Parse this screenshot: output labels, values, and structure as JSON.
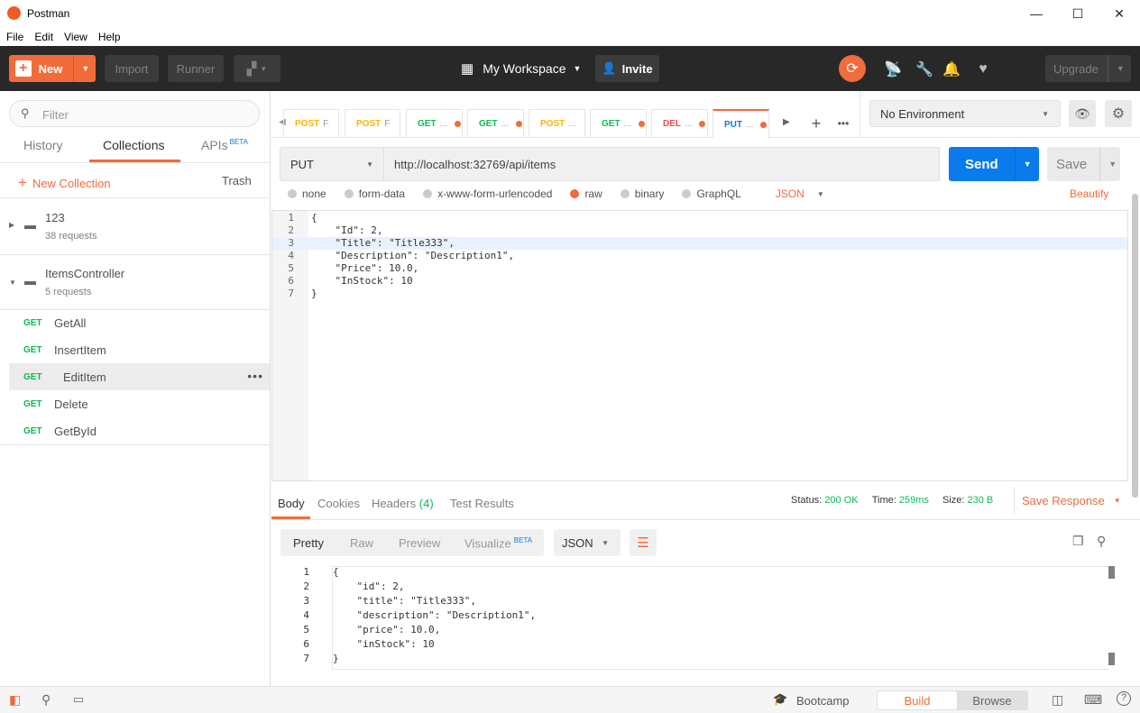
{
  "window": {
    "title": "Postman",
    "minimize": "—",
    "maximize": "☐",
    "close": "✕"
  },
  "menu": [
    "File",
    "Edit",
    "View",
    "Help"
  ],
  "header": {
    "new_label": "New",
    "import_label": "Import",
    "runner_label": "Runner",
    "workspace_label": "My Workspace",
    "invite_label": "Invite",
    "upgrade_label": "Upgrade"
  },
  "sidebar": {
    "filter_placeholder": "Filter",
    "tabs": [
      "History",
      "Collections",
      "APIs"
    ],
    "apis_badge": "BETA",
    "new_collection": "New Collection",
    "trash": "Trash",
    "collections": [
      {
        "name": "123",
        "count": "38 requests"
      },
      {
        "name": "ItemsController",
        "count": "5 requests"
      }
    ],
    "requests": [
      {
        "method": "GET",
        "name": "GetAll"
      },
      {
        "method": "GET",
        "name": "InsertItem"
      },
      {
        "method": "GET",
        "name": "EditItem"
      },
      {
        "method": "GET",
        "name": "Delete"
      },
      {
        "method": "GET",
        "name": "GetById"
      }
    ]
  },
  "tabs": [
    {
      "method": "POST",
      "suffix": "F"
    },
    {
      "method": "POST",
      "suffix": "F"
    },
    {
      "method": "GET",
      "suffix": "..."
    },
    {
      "method": "GET",
      "suffix": "..."
    },
    {
      "method": "POST",
      "suffix": "..."
    },
    {
      "method": "GET",
      "suffix": "..."
    },
    {
      "method": "DEL",
      "suffix": "..."
    },
    {
      "method": "PUT",
      "suffix": "..."
    }
  ],
  "environment": {
    "selected": "No Environment"
  },
  "request": {
    "method": "PUT",
    "url": "http://localhost:32769/api/items",
    "send_label": "Send",
    "save_label": "Save",
    "body_types": [
      "none",
      "form-data",
      "x-www-form-urlencoded",
      "raw",
      "binary",
      "GraphQL"
    ],
    "format": "JSON",
    "beautify": "Beautify",
    "body_lines": [
      "{",
      "    \"Id\": 2,",
      "    \"Title\": \"Title333\",",
      "    \"Description\": \"Description1\",",
      "    \"Price\": 10.0,",
      "    \"InStock\": 10",
      "}"
    ]
  },
  "response": {
    "tabs": [
      "Body",
      "Cookies",
      "Headers",
      "Test Results"
    ],
    "headers_count": "(4)",
    "status_label": "Status:",
    "status_value": "200 OK",
    "time_label": "Time:",
    "time_value": "259ms",
    "size_label": "Size:",
    "size_value": "230 B",
    "save_response": "Save Response",
    "view_modes": [
      "Pretty",
      "Raw",
      "Preview",
      "Visualize"
    ],
    "visualize_badge": "BETA",
    "format": "JSON",
    "body_lines": [
      "{",
      "    \"id\": 2,",
      "    \"title\": \"Title333\",",
      "    \"description\": \"Description1\",",
      "    \"price\": 10.0,",
      "    \"inStock\": 10",
      "}"
    ]
  },
  "footer": {
    "bootcamp": "Bootcamp",
    "build": "Build",
    "browse": "Browse"
  },
  "colors": {
    "brand": "#f26b3a",
    "send": "#097bed",
    "get": "#0cbb52",
    "post": "#ffb400",
    "put": "#097bed",
    "del": "#ed4b48"
  }
}
